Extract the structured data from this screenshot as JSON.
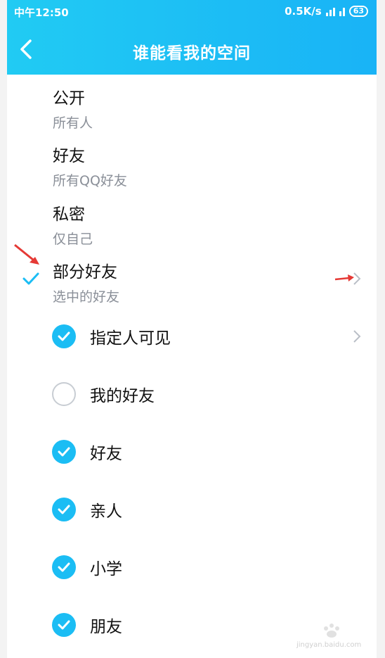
{
  "status_bar": {
    "time": "中午12:50",
    "speed": "0.5K/s",
    "battery": "63"
  },
  "header": {
    "title": "谁能看我的空间"
  },
  "options": [
    {
      "label": "公开",
      "sub": "所有人"
    },
    {
      "label": "好友",
      "sub": "所有QQ好友"
    },
    {
      "label": "私密",
      "sub": "仅自己"
    },
    {
      "label": "部分好友",
      "sub": "选中的好友"
    }
  ],
  "groups": [
    {
      "label": "指定人可见",
      "checked": true
    },
    {
      "label": "我的好友",
      "checked": false
    },
    {
      "label": "好友",
      "checked": true
    },
    {
      "label": "亲人",
      "checked": true
    },
    {
      "label": "小学",
      "checked": true
    },
    {
      "label": "朋友",
      "checked": true
    }
  ],
  "watermark": {
    "text": "jingyan.baidu.com"
  },
  "colors": {
    "accent": "#1bbdf4",
    "annotation": "#e53935"
  }
}
